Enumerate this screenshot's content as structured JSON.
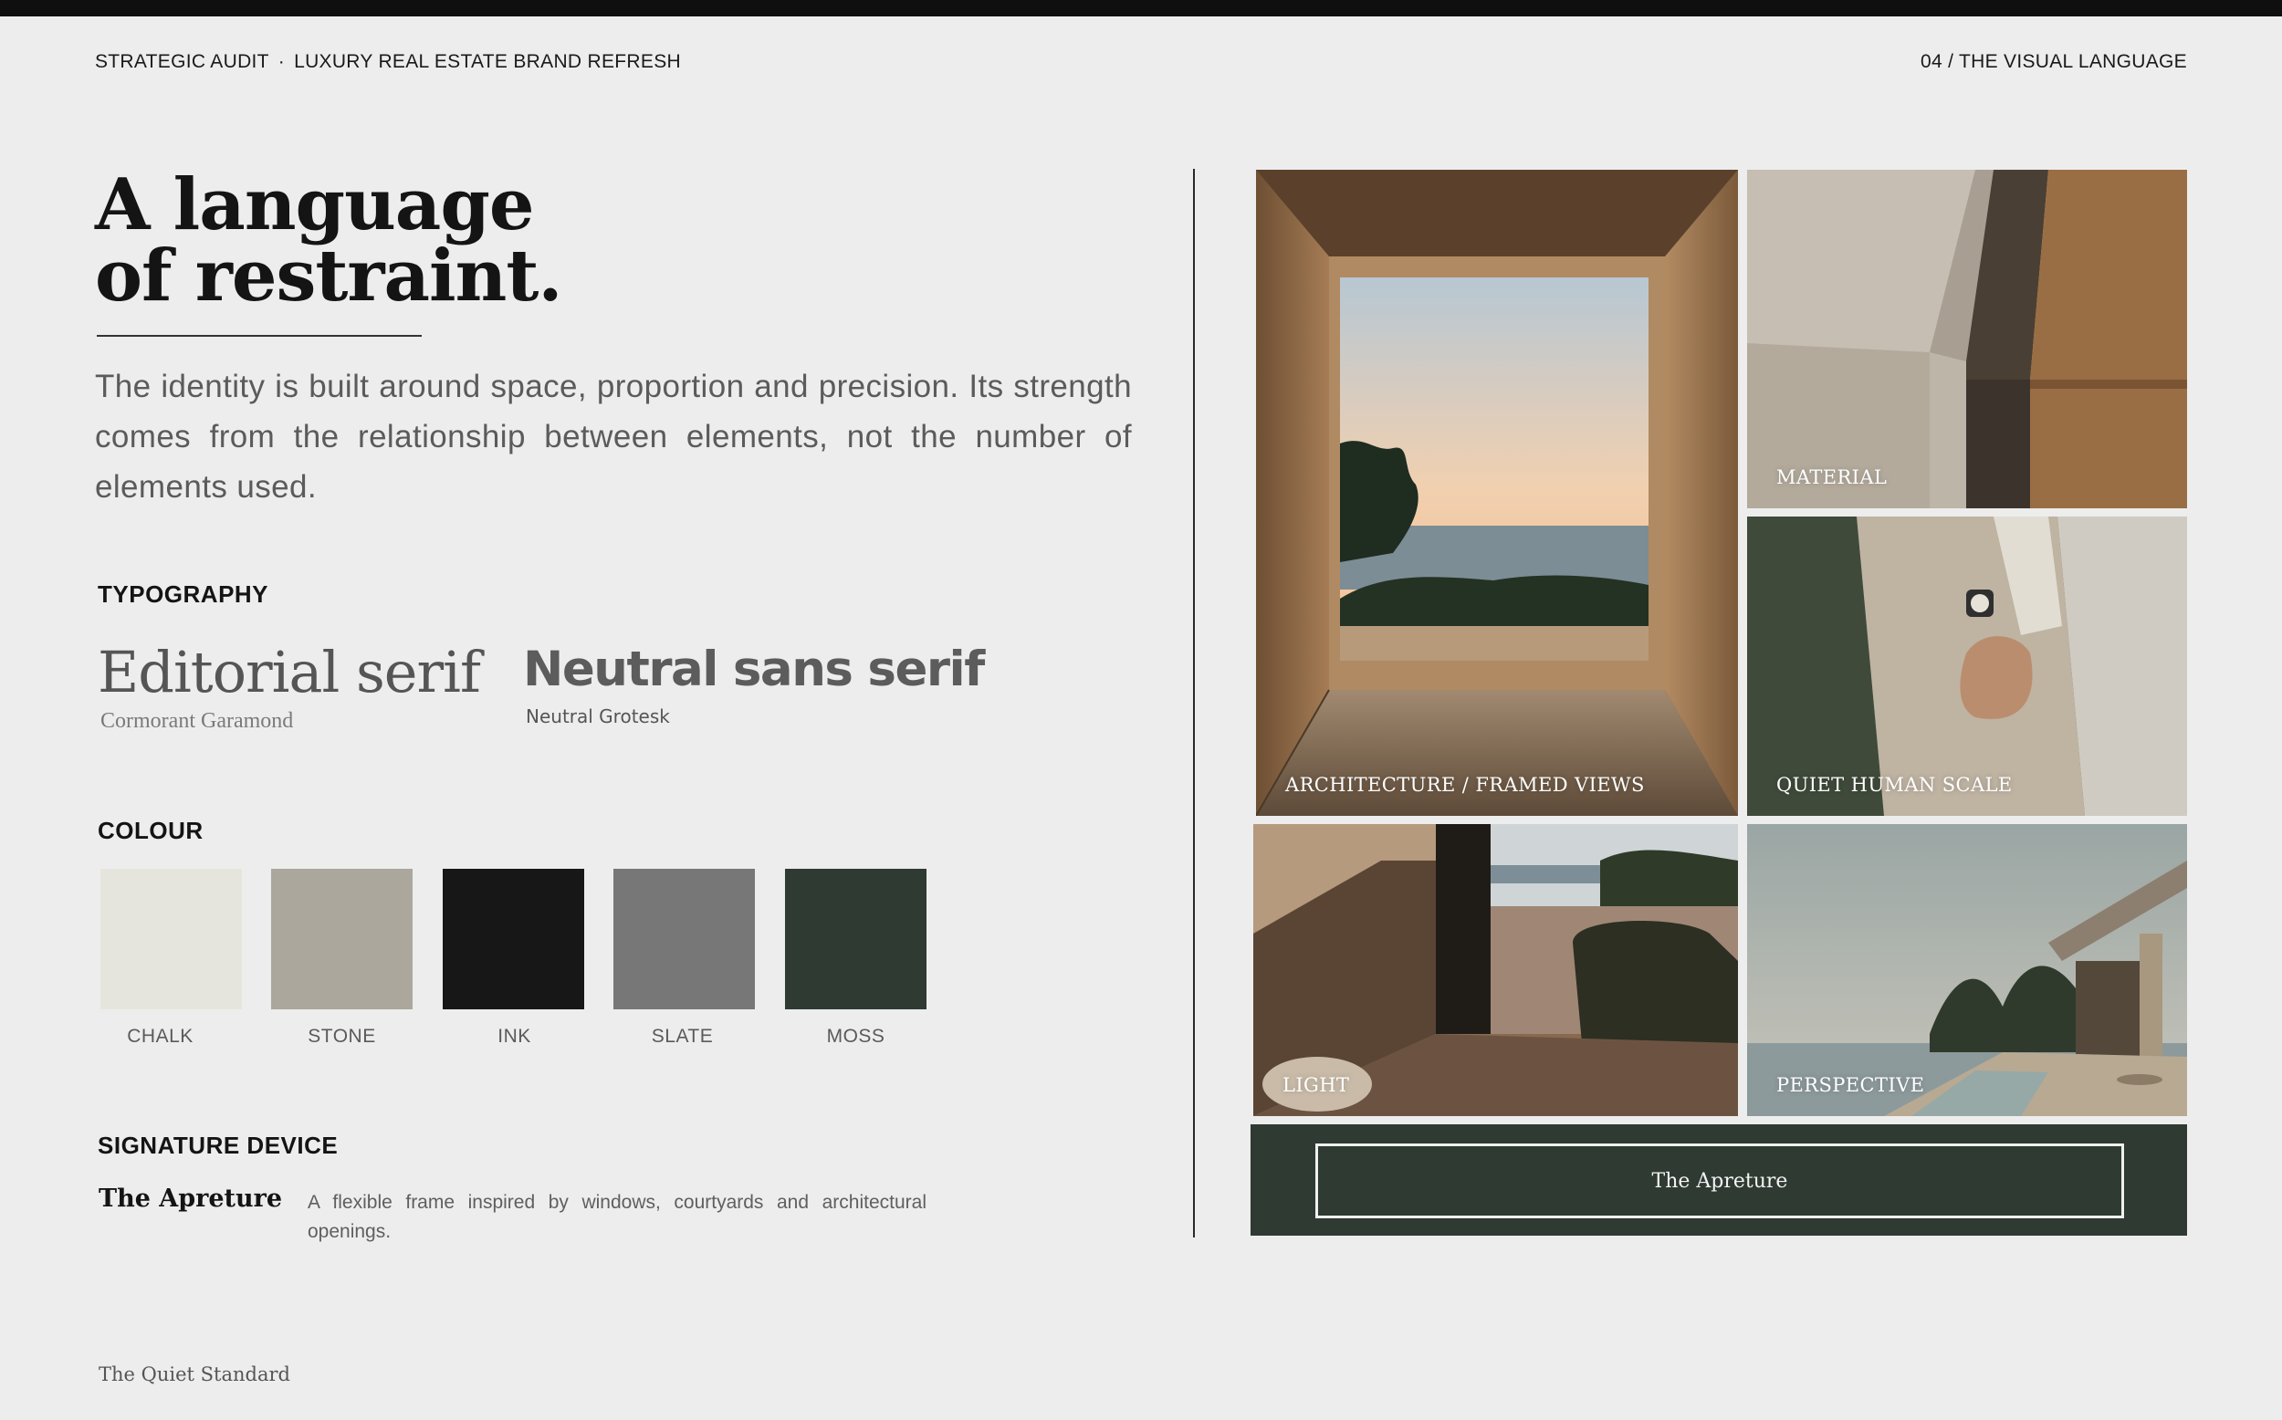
{
  "header": {
    "left_part1": "STRATEGIC AUDIT",
    "separator": "·",
    "left_part2": "LUXURY REAL ESTATE BRAND REFRESH",
    "right": "04 / THE VISUAL LANGUAGE"
  },
  "title": {
    "line1": "A language",
    "line2": "of restraint."
  },
  "intro": "The identity is built around space, proportion and precision. Its strength comes from the relationship between elements, not the number of elements used.",
  "typography": {
    "label": "TYPOGRAPHY",
    "serif_name": "Editorial serif",
    "serif_font": "Cormorant Garamond",
    "sans_name": "Neutral sans serif",
    "sans_font": "Neutral Grotesk"
  },
  "colour": {
    "label": "COLOUR",
    "swatches": [
      {
        "name": "CHALK",
        "hex": "#e6e5dd"
      },
      {
        "name": "STONE",
        "hex": "#aba79d"
      },
      {
        "name": "INK",
        "hex": "#171717"
      },
      {
        "name": "SLATE",
        "hex": "#767776"
      },
      {
        "name": "MOSS",
        "hex": "#2f3a33"
      }
    ]
  },
  "signature": {
    "label": "SIGNATURE DEVICE",
    "name": "The Apreture",
    "description": "A flexible frame inspired by windows, courtyards and architectural openings."
  },
  "footer": "The Quiet Standard",
  "moodboard": {
    "captions": {
      "architecture": "ARCHITECTURE / FRAMED VIEWS",
      "material": "MATERIAL",
      "human": "QUIET HUMAN SCALE",
      "light": "LIGHT",
      "perspective": "PERSPECTIVE"
    },
    "aperture_label": "The Apreture"
  }
}
